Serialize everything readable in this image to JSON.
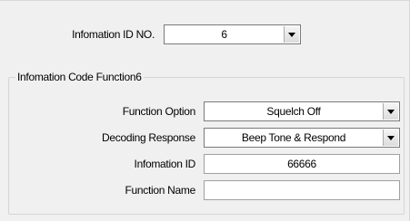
{
  "info_id": {
    "label": "Infomation ID NO.",
    "selected": "6"
  },
  "group": {
    "title": "Infomation Code Function6",
    "function_option": {
      "label": "Function Option",
      "selected": "Squelch Off"
    },
    "decoding_response": {
      "label": "Decoding Response",
      "selected": "Beep Tone & Respond"
    },
    "information_id": {
      "label": "Infomation ID",
      "value": "66666"
    },
    "function_name": {
      "label": "Function Name",
      "value": ""
    }
  },
  "icons": {
    "dropdown": "chevron-down-icon"
  }
}
